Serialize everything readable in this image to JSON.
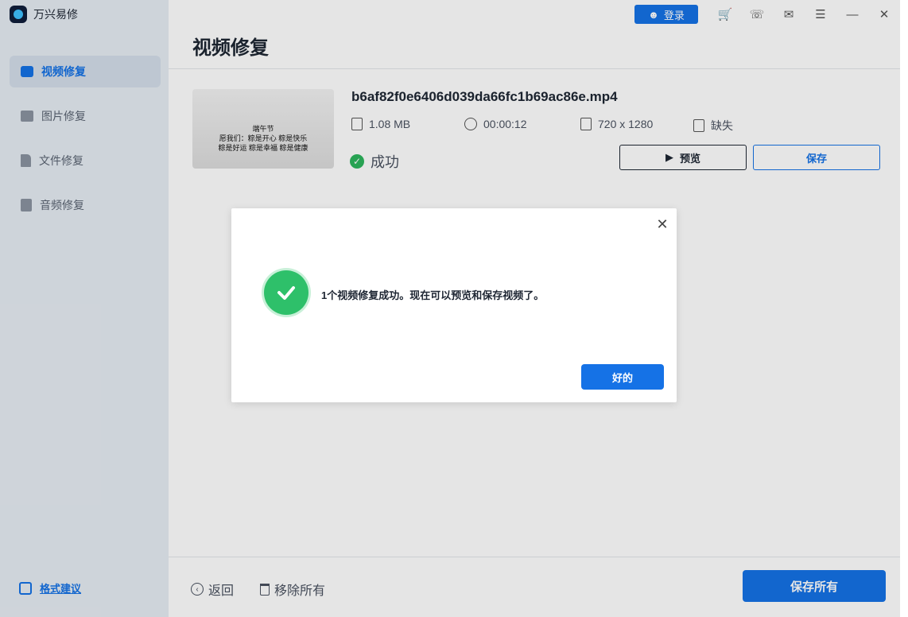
{
  "app": {
    "name": "万兴易修"
  },
  "sidebar": {
    "items": [
      {
        "label": "视频修复",
        "icon": "video-icon",
        "active": true
      },
      {
        "label": "图片修复",
        "icon": "image-icon",
        "active": false
      },
      {
        "label": "文件修复",
        "icon": "file-icon",
        "active": false
      },
      {
        "label": "音频修复",
        "icon": "audio-icon",
        "active": false
      }
    ],
    "feedback_label": "格式建议"
  },
  "topbar": {
    "login_label": "登录",
    "icons": [
      "cart-icon",
      "headset-icon",
      "mail-icon",
      "menu-icon",
      "minimize-icon",
      "close-icon"
    ]
  },
  "main": {
    "title": "视频修复",
    "file": {
      "name": "b6af82f0e6406d039da66fc1b69ac86e.mp4",
      "size": "1.08  MB",
      "duration": "00:00:12",
      "resolution": "720 x 1280",
      "missing": "缺失",
      "status": "成功",
      "thumbnail_lines": [
        "端午节",
        "愿我们：粽是开心 粽是快乐",
        "粽是好运 粽是幸福 粽是健康"
      ],
      "preview_label": "预览",
      "save_label": "保存"
    }
  },
  "footer": {
    "back_label": "返回",
    "remove_all_label": "移除所有",
    "save_all_label": "保存所有"
  },
  "modal": {
    "message": "1个视频修复成功。现在可以预览和保存视频了。",
    "ok_label": "好的"
  },
  "colors": {
    "accent": "#1572e6",
    "success": "#2ec06a",
    "sidebar_bg": "#e6ecf3"
  }
}
